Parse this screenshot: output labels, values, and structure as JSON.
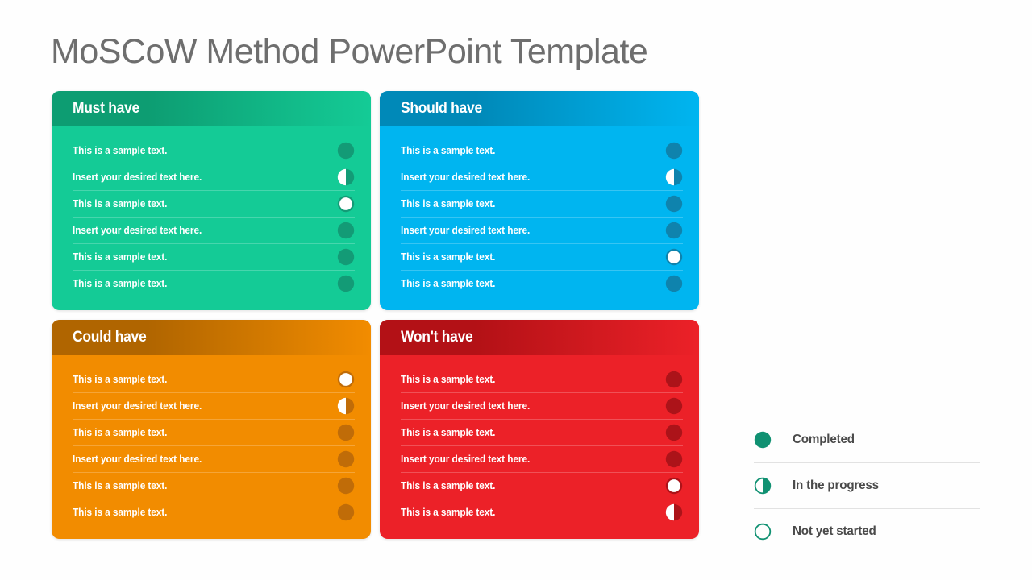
{
  "title": "MoSCoW Method PowerPoint Template",
  "colors": {
    "title_text": "#6e6e6e",
    "background": "#fefefe",
    "legend_accent": "#109172",
    "legend_text": "#4a4a4a",
    "must_have": "#14cb96",
    "must_have_header": "#0d9d72",
    "must_have_dot": "#139b76",
    "should_have": "#00b5f0",
    "should_have_header": "#0089b8",
    "should_have_dot": "#0f83ad",
    "could_have": "#f28c00",
    "could_have_header": "#b06500",
    "could_have_dot": "#c06c08",
    "wont_have": "#ec2128",
    "wont_have_header": "#b31116",
    "wont_have_dot": "#ac1319"
  },
  "quadrants": [
    {
      "id": "must-have",
      "title": "Must have",
      "rows": [
        {
          "text": "This is a sample text.",
          "status": "completed"
        },
        {
          "text": "Insert your desired text here.",
          "status": "in-progress"
        },
        {
          "text": "This is a sample text.",
          "status": "not-started"
        },
        {
          "text": "Insert your desired text here.",
          "status": "completed"
        },
        {
          "text": "This is a sample text.",
          "status": "completed"
        },
        {
          "text": "This is a sample text.",
          "status": "completed"
        }
      ]
    },
    {
      "id": "should-have",
      "title": "Should have",
      "rows": [
        {
          "text": "This is a sample text.",
          "status": "completed"
        },
        {
          "text": "Insert your desired text here.",
          "status": "in-progress"
        },
        {
          "text": "This is a sample text.",
          "status": "completed"
        },
        {
          "text": "Insert your desired text here.",
          "status": "completed"
        },
        {
          "text": "This is a sample text.",
          "status": "not-started"
        },
        {
          "text": "This is a sample text.",
          "status": "completed"
        }
      ]
    },
    {
      "id": "could-have",
      "title": "Could have",
      "rows": [
        {
          "text": "This is a sample text.",
          "status": "not-started"
        },
        {
          "text": "Insert your desired text here.",
          "status": "in-progress"
        },
        {
          "text": "This is a sample text.",
          "status": "completed"
        },
        {
          "text": "Insert your desired text here.",
          "status": "completed"
        },
        {
          "text": "This is a sample text.",
          "status": "completed"
        },
        {
          "text": "This is a sample text.",
          "status": "completed"
        }
      ]
    },
    {
      "id": "wont-have",
      "title": "Won't have",
      "rows": [
        {
          "text": "This is a sample text.",
          "status": "completed"
        },
        {
          "text": "Insert your desired text here.",
          "status": "completed"
        },
        {
          "text": "This is a sample text.",
          "status": "completed"
        },
        {
          "text": "Insert your desired text here.",
          "status": "completed"
        },
        {
          "text": "This is a sample text.",
          "status": "not-started"
        },
        {
          "text": "This is a sample text.",
          "status": "in-progress"
        }
      ]
    }
  ],
  "legend": [
    {
      "icon": "completed-circle-icon",
      "status": "completed",
      "label": "Completed"
    },
    {
      "icon": "in-progress-half-circle-icon",
      "status": "in-progress",
      "label": "In the progress"
    },
    {
      "icon": "not-started-ring-icon",
      "status": "not-started",
      "label": "Not yet started"
    }
  ]
}
